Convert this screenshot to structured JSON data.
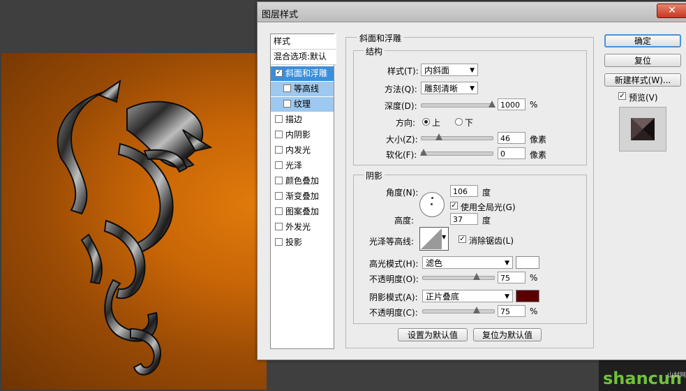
{
  "dialog": {
    "title": "图层样式",
    "close_label": "✕"
  },
  "style_list": {
    "header": "样式",
    "blend_options": "混合选项:默认",
    "items": [
      {
        "label": "斜面和浮雕",
        "checked": true,
        "state": "selected"
      },
      {
        "label": "等高线",
        "checked": false,
        "state": "sub"
      },
      {
        "label": "纹理",
        "checked": false,
        "state": "sub"
      },
      {
        "label": "描边",
        "checked": false,
        "state": "normal"
      },
      {
        "label": "内阴影",
        "checked": false,
        "state": "normal"
      },
      {
        "label": "内发光",
        "checked": false,
        "state": "normal"
      },
      {
        "label": "光泽",
        "checked": false,
        "state": "normal"
      },
      {
        "label": "颜色叠加",
        "checked": false,
        "state": "normal"
      },
      {
        "label": "渐变叠加",
        "checked": false,
        "state": "normal"
      },
      {
        "label": "图案叠加",
        "checked": false,
        "state": "normal"
      },
      {
        "label": "外发光",
        "checked": false,
        "state": "normal"
      },
      {
        "label": "投影",
        "checked": false,
        "state": "normal"
      }
    ]
  },
  "bevel": {
    "section_title": "斜面和浮雕",
    "structure": {
      "title": "结构",
      "style_label": "样式(T):",
      "style_value": "内斜面",
      "technique_label": "方法(Q):",
      "technique_value": "雕刻清晰",
      "depth_label": "深度(D):",
      "depth_value": "1000",
      "depth_unit": "%",
      "direction_label": "方向:",
      "direction_up": "上",
      "direction_down": "下",
      "size_label": "大小(Z):",
      "size_value": "46",
      "size_unit": "像素",
      "soften_label": "软化(F):",
      "soften_value": "0",
      "soften_unit": "像素"
    },
    "shading": {
      "title": "阴影",
      "angle_label": "角度(N):",
      "angle_value": "106",
      "angle_unit": "度",
      "global_light_label": "使用全局光(G)",
      "altitude_label": "高度:",
      "altitude_value": "37",
      "altitude_unit": "度",
      "gloss_contour_label": "光泽等高线:",
      "antialias_label": "消除锯齿(L)",
      "highlight_mode_label": "高光模式(H):",
      "highlight_mode_value": "滤色",
      "highlight_color": "#ffffff",
      "highlight_opacity_label": "不透明度(O):",
      "highlight_opacity_value": "75",
      "shadow_mode_label": "阴影模式(A):",
      "shadow_mode_value": "正片叠底",
      "shadow_color": "#5a0000",
      "shadow_opacity_label": "不透明度(C):",
      "shadow_opacity_value": "75",
      "percent": "%"
    },
    "make_default": "设置为默认值",
    "reset_default": "复位为默认值"
  },
  "buttons": {
    "ok": "确定",
    "reset": "复位",
    "new_style": "新建样式(W)...",
    "preview_label": "预览(V)"
  },
  "watermark": {
    "text": "shancun",
    "sub": "山村网"
  }
}
